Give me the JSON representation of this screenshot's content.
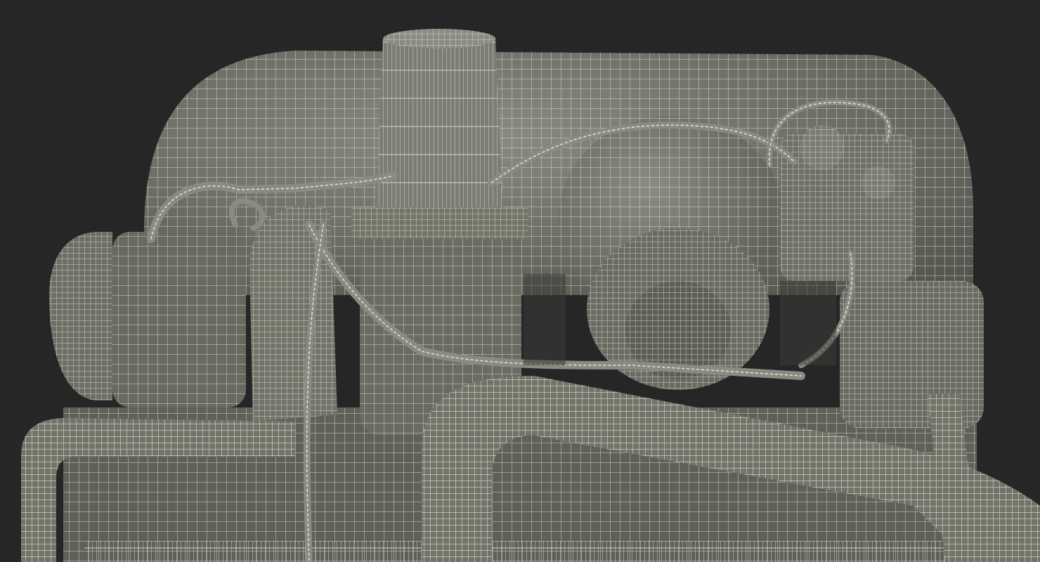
{
  "scene": {
    "subject": "engine-wireframe-render",
    "colors": {
      "background": "#262626",
      "surface": "#6e6f66",
      "surface_dark": "#55564f",
      "surface_light": "#8a8b82",
      "wire": "#e6e6d8"
    }
  }
}
